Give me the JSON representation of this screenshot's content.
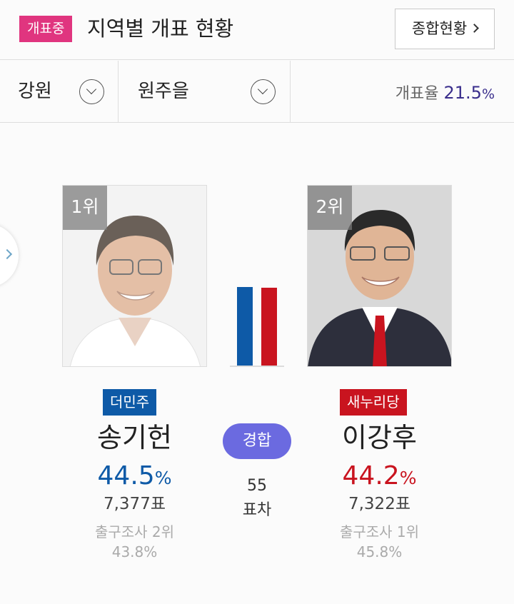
{
  "header": {
    "live_badge": "개표중",
    "title": "지역별 개표 현황",
    "summary_button": "종합현황"
  },
  "filters": {
    "region": "강원",
    "district": "원주을",
    "count_rate_label": "개표율",
    "count_rate_value": "21.5",
    "count_rate_unit": "%"
  },
  "colors": {
    "live_badge": "#e0357f",
    "minjoo": "#0e5aa7",
    "saenuri": "#c9141f",
    "race_badge": "#6b6ae0",
    "count_rate": "#3a2e8c"
  },
  "candidates": [
    {
      "rank": "1위",
      "party": "더민주",
      "name": "송기헌",
      "vote_share": "44.5",
      "vote_share_unit": "%",
      "votes": "7,377표",
      "exit_poll_label": "출구조사 2위",
      "exit_poll_pct": "43.8%"
    },
    {
      "rank": "2위",
      "party": "새누리당",
      "name": "이강후",
      "vote_share": "44.2",
      "vote_share_unit": "%",
      "votes": "7,322표",
      "exit_poll_label": "출구조사 1위",
      "exit_poll_pct": "45.8%"
    }
  ],
  "comparison": {
    "status": "경합",
    "margin": "55",
    "margin_label": "표차",
    "bar_values": [
      44.5,
      44.2
    ]
  },
  "icons": {
    "summary_chevron": "chevron-right-icon",
    "region_dropdown": "chevron-down-circle-icon",
    "district_dropdown": "chevron-down-circle-icon",
    "side_nav": "chevron-right-icon"
  }
}
